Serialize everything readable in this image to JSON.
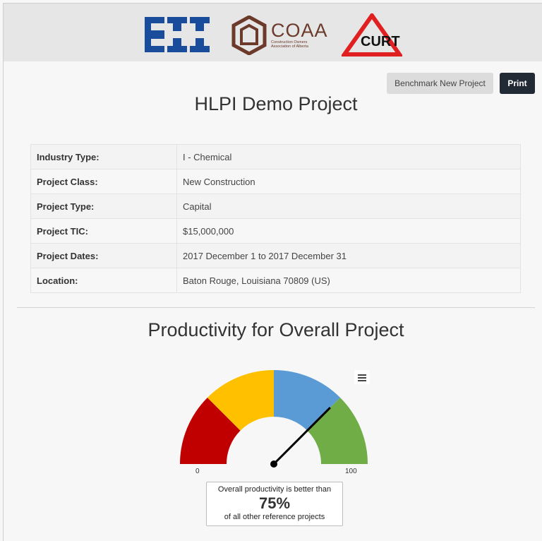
{
  "header": {
    "logos": [
      {
        "name": "cii-logo",
        "text": "CII"
      },
      {
        "name": "coaa-logo",
        "text": "COAA",
        "subtext": "Construction Owners Association of Alberta"
      },
      {
        "name": "curt-logo",
        "text": "CURT"
      }
    ]
  },
  "toolbar": {
    "benchmark_label": "Benchmark New Project",
    "print_label": "Print"
  },
  "project": {
    "title": "HLPI Demo Project",
    "details": [
      {
        "label": "Industry Type:",
        "value": "I - Chemical"
      },
      {
        "label": "Project Class:",
        "value": "New Construction"
      },
      {
        "label": "Project Type:",
        "value": "Capital"
      },
      {
        "label": "Project TIC:",
        "value": "$15,000,000"
      },
      {
        "label": "Project Dates:",
        "value": "2017 December 1 to 2017 December 31"
      },
      {
        "label": "Location:",
        "value": "Baton Rouge, Louisiana 70809 (US)"
      }
    ]
  },
  "productivity": {
    "title": "Productivity for Overall Project",
    "gauge": {
      "min": 0,
      "max": 100,
      "min_label": "0",
      "max_label": "100",
      "value": 75,
      "bands": [
        {
          "from": 0,
          "to": 25,
          "color": "#c00000"
        },
        {
          "from": 25,
          "to": 50,
          "color": "#ffc000"
        },
        {
          "from": 50,
          "to": 75,
          "color": "#5b9bd5"
        },
        {
          "from": 75,
          "to": 100,
          "color": "#70ad47"
        }
      ]
    },
    "summary": {
      "line1": "Overall productivity is better than",
      "value": "75%",
      "line2": "of all other reference projects"
    },
    "menu_icon": "hamburger-menu-icon"
  }
}
